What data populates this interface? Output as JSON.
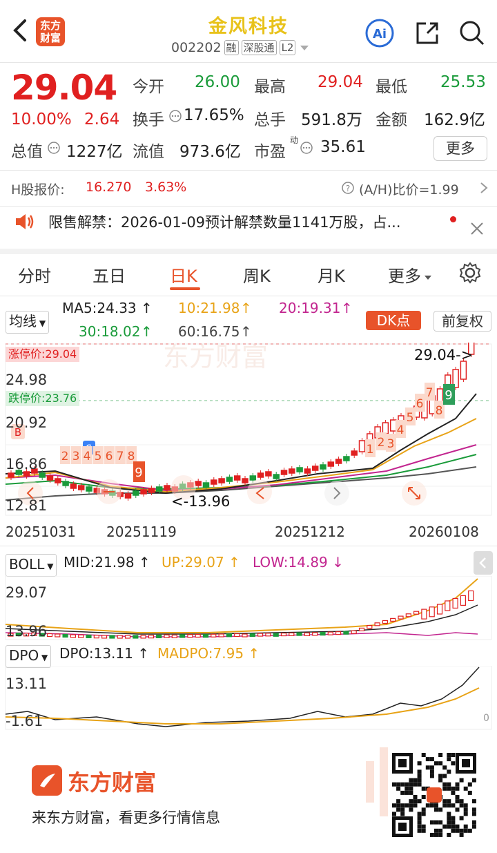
{
  "header": {
    "title": "金风科技",
    "code": "002202",
    "tags": [
      "融",
      "深股通",
      "L2"
    ]
  },
  "quote": {
    "price": "29.04",
    "change_pct": "10.00%",
    "change": "2.64",
    "open_label": "今开",
    "open": "26.00",
    "high_label": "最高",
    "high": "29.04",
    "low_label": "最低",
    "low": "25.53",
    "turnover_label": "换手",
    "turnover": "17.65%",
    "volume_label": "总手",
    "volume": "591.8万",
    "amount_label": "金额",
    "amount": "162.9亿",
    "mcap_label": "总值",
    "mcap": "1227亿",
    "float_label": "流值",
    "float": "973.6亿",
    "pe_label": "市盈",
    "pe_sup": "动",
    "pe": "35.61",
    "more": "更多"
  },
  "hshare": {
    "label": "H股报价:",
    "price": "16.270",
    "pct": "3.63%",
    "ratio": "(A/H)比价=1.99"
  },
  "notice": {
    "text": "限售解禁：2026-01-09预计解禁数量1141万股，占..."
  },
  "tabs": [
    "分时",
    "五日",
    "日K",
    "周K",
    "月K",
    "更多"
  ],
  "ma": {
    "selector": "均线",
    "ma5": "MA5:24.33",
    "ma10": "10:21.98",
    "ma20": "20:19.31",
    "ma30": "30:18.02",
    "ma60": "60:16.75",
    "dk": "DK点",
    "fq": "前复权"
  },
  "kline": {
    "zt": "涨停价:29.04",
    "dt": "跌停价:23.76",
    "y1": "29.04",
    "y2": "24.98",
    "y3": "20.92",
    "y4": "16.86",
    "y5": "12.81",
    "last": "29.04",
    "min": "13.96",
    "dates": [
      "20251031",
      "20251119",
      "20251212",
      "20260108"
    ]
  },
  "boll": {
    "selector": "BOLL",
    "mid": "MID:21.98",
    "up": "UP:29.07",
    "low": "LOW:14.89",
    "y1": "29.07",
    "y2": "13.96"
  },
  "dpo": {
    "selector": "DPO",
    "dpo": "DPO:13.11",
    "madpo": "MADPO:7.95",
    "y1": "13.11",
    "y2": "-1.61",
    "zero": "0"
  },
  "footer": {
    "brand": "东方财富",
    "slogan": "来东方财富，看更多行情信息",
    "logo_text": "东方财富"
  },
  "colors": {
    "up": "#e02020",
    "down": "#1a9b3a",
    "accent": "#e8532a",
    "title": "#e8c21a"
  }
}
